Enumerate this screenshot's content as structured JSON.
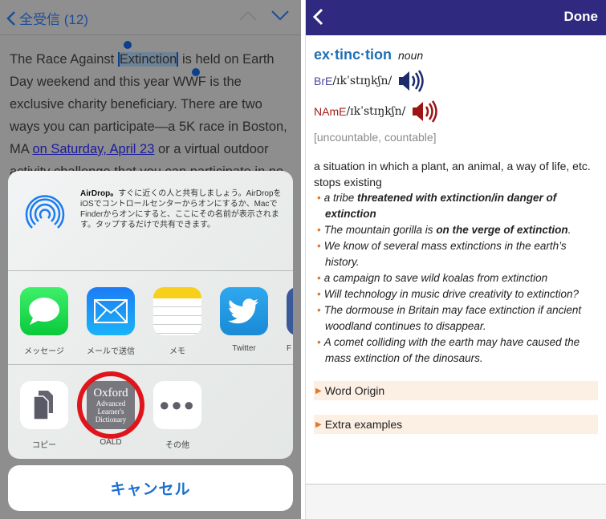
{
  "mail": {
    "back_label": "全受信 (12)",
    "body_before": "The Race Against ",
    "selected": "Extinction",
    "body_after": " is held on Earth Day weekend and this year WWF is the exclusive charity beneficiary. There are two ways you can participate—a 5K race in Boston, MA ",
    "link": "on Saturday, April 23",
    "body_end": " or a virtual outdoor activity challenge that you can participate in no"
  },
  "share": {
    "airdrop_title": "AirDrop。",
    "airdrop_text": "すぐに近くの人と共有しましょう。AirDropをiOSでコントロールセンターからオンにするか、MacでFinderからオンにすると、ここにその名前が表示されます。タップするだけで共有できます。",
    "apps": [
      {
        "label": "メッセージ"
      },
      {
        "label": "メールで送信"
      },
      {
        "label": "メモ"
      },
      {
        "label": "Twitter"
      },
      {
        "label": "F"
      }
    ],
    "actions": [
      {
        "label": "コピー"
      },
      {
        "label": "OALD",
        "icon_text": [
          "Oxford",
          "Advanced",
          "Learner's",
          "Dictionary"
        ]
      },
      {
        "label": "その他"
      }
    ],
    "cancel": "キャンセル",
    "highlight_color": "#e0151b"
  },
  "dict": {
    "done": "Done",
    "headword": "ex·tinc·tion",
    "pos": "noun",
    "bre_label": "BrE",
    "bre_ipa": "/ɪkˈstɪŋkʃn/",
    "name_label": "NAmE",
    "name_ipa": "/ɪkˈstɪŋkʃn/",
    "grammar": "[uncountable, countable]",
    "definition": "a situation in which a plant, an animal, a way of life, etc. stops existing",
    "examples": [
      {
        "a": "a tribe ",
        "b": "threatened with extinction/in danger of extinction",
        "c": ""
      },
      {
        "a": "The mountain gorilla is ",
        "b": "on the verge of extinction",
        "c": "."
      },
      {
        "a": "We know of several mass extinctions in the earth’s history.",
        "b": "",
        "c": ""
      },
      {
        "a": "a campaign to save wild koalas from extinction",
        "b": "",
        "c": ""
      },
      {
        "a": "Will technology in music drive creativity to extinction?",
        "b": "",
        "c": ""
      },
      {
        "a": "The dormouse in Britain may face extinction if ancient woodland continues to disappear.",
        "b": "",
        "c": ""
      },
      {
        "a": "A comet colliding with the earth may have caused the mass extinction of the dinosaurs.",
        "b": "",
        "c": ""
      }
    ],
    "word_origin": "Word Origin",
    "extra_examples": "Extra examples",
    "colors": {
      "header": "#2f2a80",
      "headword": "#1f6fb5",
      "bre": "#4b4b9b",
      "name": "#a01c1c"
    }
  }
}
